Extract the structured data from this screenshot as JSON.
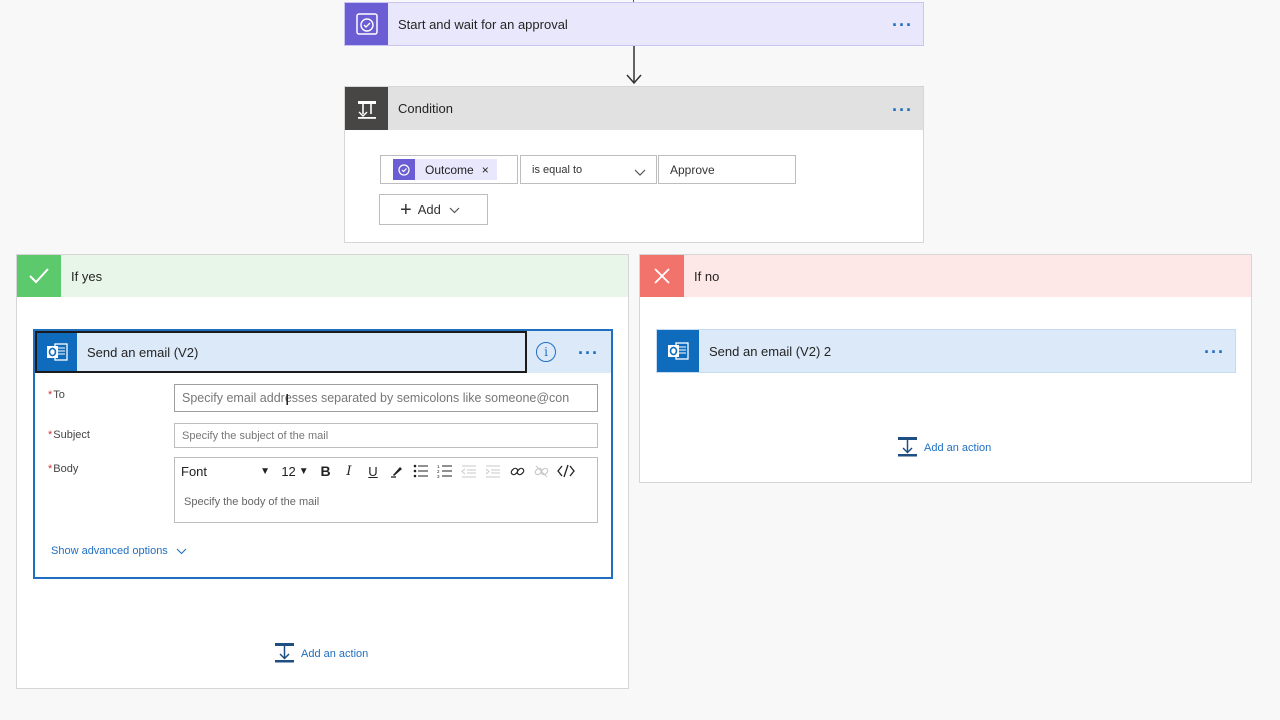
{
  "approval": {
    "title": "Start and wait for an approval",
    "color": "#6b5dd3"
  },
  "condition": {
    "title": "Condition",
    "token_label": "Outcome",
    "operator": "is equal to",
    "value": "Approve",
    "add_label": "Add"
  },
  "if_yes": {
    "title": "If yes",
    "email_card": {
      "title": "Send an email (V2)",
      "to_label": "To",
      "to_placeholder": "Specify email addresses separated by semicolons like someone@con",
      "subject_label": "Subject",
      "subject_placeholder": "Specify the subject of the mail",
      "body_label": "Body",
      "font_label": "Font",
      "font_size": "12",
      "body_placeholder": "Specify the body of the mail",
      "advanced_label": "Show advanced options"
    },
    "add_action_label": "Add an action"
  },
  "if_no": {
    "title": "If no",
    "email_card": {
      "title": "Send an email (V2) 2"
    },
    "add_action_label": "Add an action"
  },
  "colors": {
    "yes": "#5cc96c",
    "no": "#f1736b",
    "outlook": "#0f6cbd",
    "accent": "#1f6fc1"
  },
  "icons": [
    "approval-icon",
    "condition-icon",
    "check-icon",
    "close-icon",
    "outlook-icon",
    "info-icon",
    "add-action-icon"
  ]
}
